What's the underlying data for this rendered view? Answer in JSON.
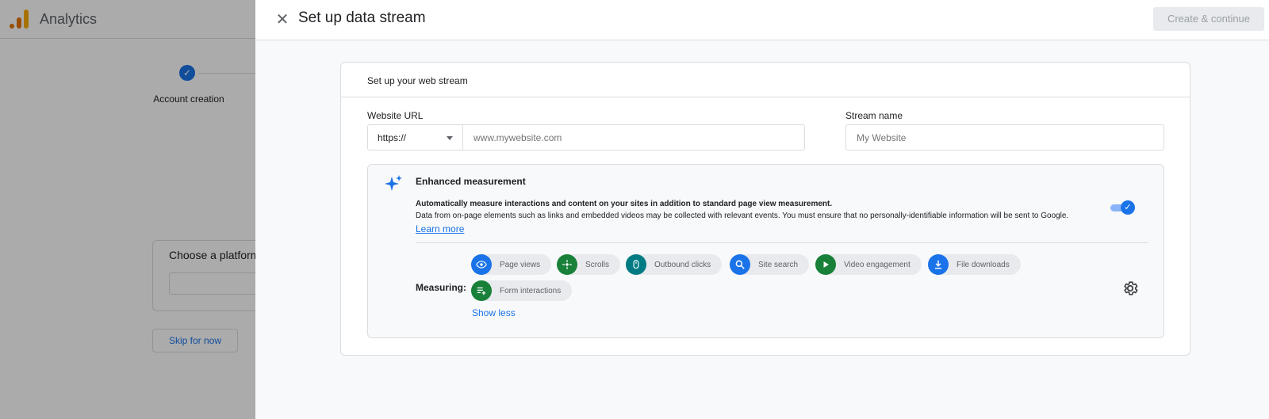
{
  "app": {
    "name": "Analytics"
  },
  "stepper": {
    "step_check": "✓",
    "step_label": "Account creation"
  },
  "platform": {
    "title": "Choose a platform"
  },
  "skip_label": "Skip for now",
  "panel": {
    "close_glyph": "✕",
    "title": "Set up data stream",
    "create_label": "Create & continue"
  },
  "card": {
    "heading": "Set up your web stream",
    "url_label": "Website URL",
    "protocol": "https://",
    "url_placeholder": "www.mywebsite.com",
    "stream_label": "Stream name",
    "stream_placeholder": "My Website"
  },
  "enhanced": {
    "title": "Enhanced measurement",
    "desc_bold": "Automatically measure interactions and content on your sites in addition to standard page view measurement.",
    "desc": "Data from on-page elements such as links and embedded videos may be collected with relevant events. You must ensure that no personally-identifiable information will be sent to Google.",
    "learn_more": "Learn more",
    "toggle_on": true,
    "toggle_check": "✓",
    "measuring_label": "Measuring:",
    "show_less": "Show less",
    "chips": [
      {
        "label": "Page views",
        "icon": "eye-icon",
        "color": "#1a73e8"
      },
      {
        "label": "Scrolls",
        "icon": "scroll-crosshair-icon",
        "color": "#188038"
      },
      {
        "label": "Outbound clicks",
        "icon": "mouse-icon",
        "color": "#007b83"
      },
      {
        "label": "Site search",
        "icon": "search-icon",
        "color": "#1a73e8"
      },
      {
        "label": "Video engagement",
        "icon": "play-icon",
        "color": "#188038"
      },
      {
        "label": "File downloads",
        "icon": "download-icon",
        "color": "#1a73e8"
      },
      {
        "label": "Form interactions",
        "icon": "form-list-icon",
        "color": "#188038"
      }
    ]
  },
  "colors": {
    "accent": "#1a73e8",
    "green": "#188038",
    "teal": "#007b83",
    "brand_orange": "#e37400",
    "brand_yellow": "#f9ab00"
  }
}
